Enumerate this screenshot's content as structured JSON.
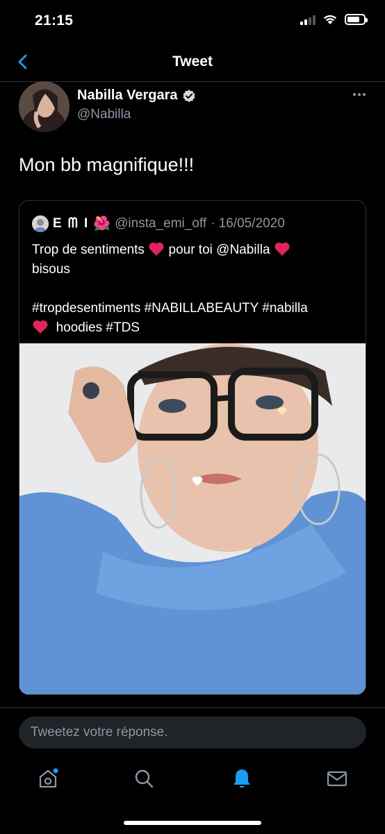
{
  "status_bar": {
    "time": "21:15",
    "battery_level": 0.75
  },
  "nav": {
    "title": "Tweet",
    "back_icon": "chevron-left-icon"
  },
  "tweet": {
    "author_name": "Nabilla Vergara",
    "author_handle": "@Nabilla",
    "verified": true,
    "text": "Mon bb magnifique!!!"
  },
  "quote": {
    "name": "E ᗰ I",
    "handle": "@insta_emi_off",
    "date": "· 16/05/2020",
    "line1_a": "Trop de sentiments",
    "line1_b": "pour toi @Nabilla",
    "line2": "bisous",
    "line3": "#tropdesentiments #NABILLABEAUTY #nabilla",
    "line4": "hoodies #TDS"
  },
  "reply": {
    "placeholder": "Tweetez votre réponse."
  },
  "tabbar": {
    "items": [
      "home-icon",
      "search-icon",
      "notifications-icon",
      "messages-icon"
    ],
    "active": "notifications-icon"
  },
  "colors": {
    "accent": "#1d9bf0",
    "muted": "#8b98a5",
    "heart": "#e0245e",
    "border": "#2f3336"
  }
}
